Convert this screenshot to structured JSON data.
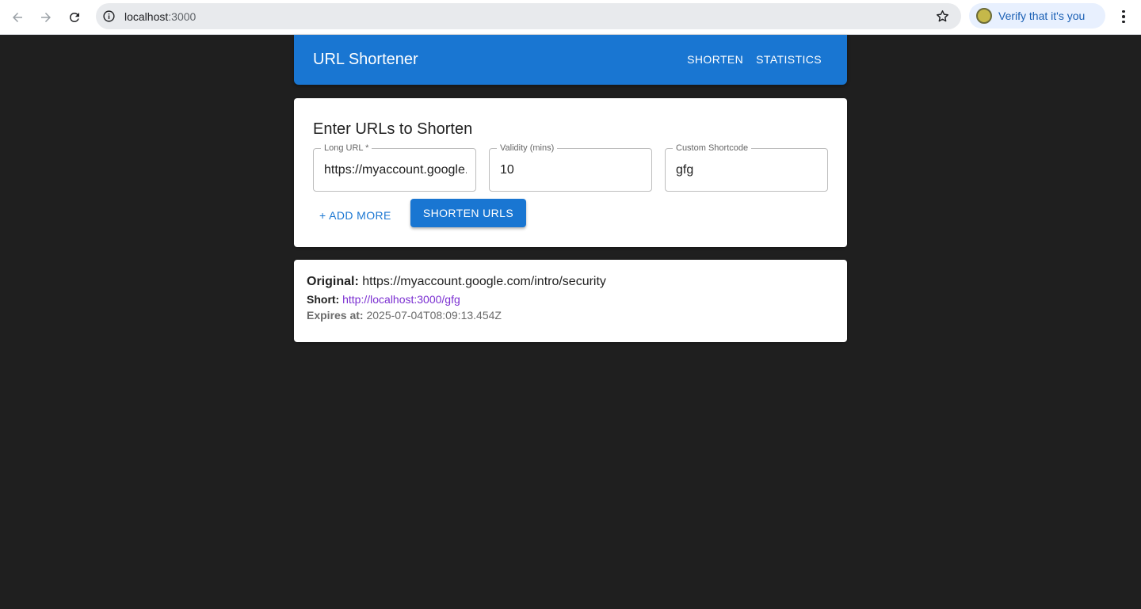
{
  "browser": {
    "url_host": "localhost",
    "url_port": ":3000",
    "profile_chip_label": "Verify that it's you"
  },
  "appbar": {
    "title": "URL Shortener",
    "nav": [
      "SHORTEN",
      "STATISTICS"
    ]
  },
  "form": {
    "heading": "Enter URLs to Shorten",
    "fields": [
      {
        "label": "Long URL *",
        "value": "https://myaccount.google.com/intro/security"
      },
      {
        "label": "Validity (mins)",
        "value": "10"
      },
      {
        "label": "Custom Shortcode",
        "value": "gfg"
      }
    ],
    "add_more_label": "+ ADD MORE",
    "submit_label": "SHORTEN URLS"
  },
  "result": {
    "original_key": "Original:",
    "original_value": "https://myaccount.google.com/intro/security",
    "short_key": "Short:",
    "short_value": "http://localhost:3000/gfg",
    "expires_key": "Expires at:",
    "expires_value": "2025-07-04T08:09:13.454Z"
  },
  "colors": {
    "primary": "#1976d2",
    "page_background": "#1f1f1f",
    "link_visited": "#7b2fd1"
  }
}
